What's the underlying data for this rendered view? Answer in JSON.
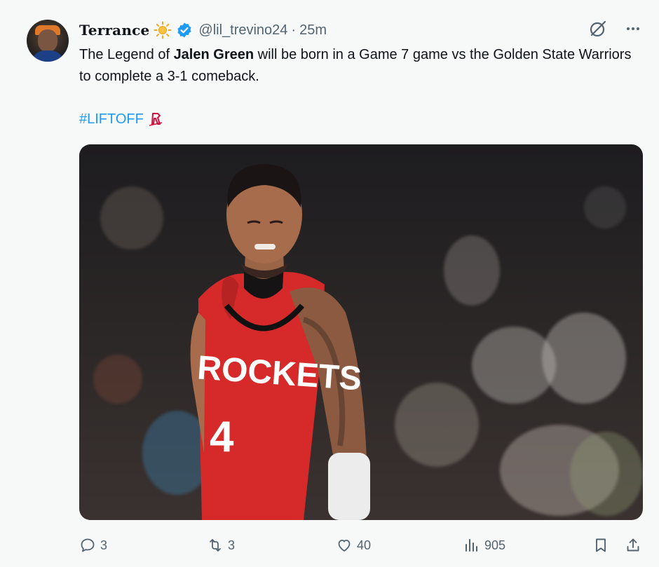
{
  "tweet": {
    "display_name": "Terrance",
    "handle": "@lil_trevino24",
    "separator": "·",
    "time": "25m",
    "text_before": "The Legend of ",
    "text_bold": "Jalen Green",
    "text_after": " will be born in a Game 7 game vs the Golden State Warriors to complete a 3-1 comeback.",
    "hashtag": "#LIFTOFF",
    "icons": {
      "name_emoji": "sun-icon",
      "verified": "verified-badge-icon",
      "grok": "grok-icon",
      "more": "more-icon",
      "hashtag_logo": "rockets-logo-icon"
    },
    "media": {
      "jersey_team": "ROCKETS",
      "jersey_number": "4"
    },
    "actions": {
      "replies": "3",
      "reposts": "3",
      "likes": "40",
      "views": "905"
    }
  },
  "colors": {
    "accent": "#1d9bf0",
    "secondary_text": "#536471",
    "jersey_red": "#d62a2a"
  }
}
